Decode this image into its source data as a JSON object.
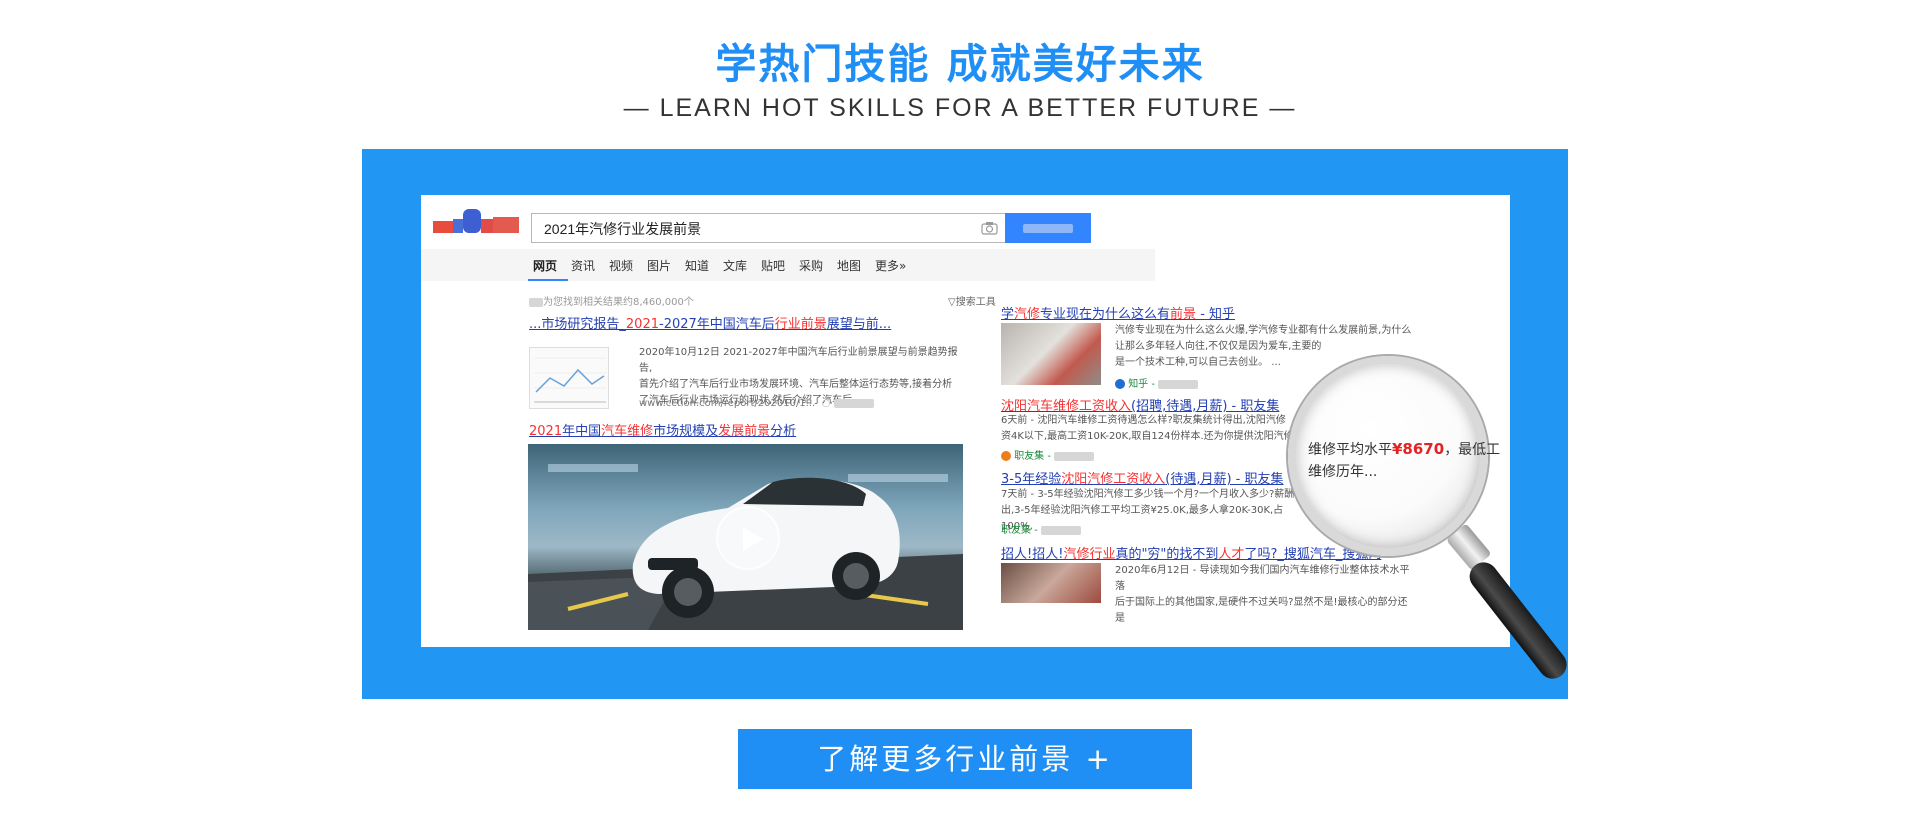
{
  "heading": {
    "title": "学热门技能 成就美好未来",
    "subtitle": "— LEARN HOT SKILLS FOR A BETTER FUTURE —"
  },
  "colors": {
    "accent": "#1f8ff5",
    "frame": "#2196f3",
    "link": "#2440b3",
    "highlight": "#f73131"
  },
  "screenshot": {
    "search": {
      "query": "2021年汽修行业发展前景",
      "button_icon": "camera-icon"
    },
    "tabs": [
      "网页",
      "资讯",
      "视频",
      "图片",
      "知道",
      "文库",
      "贴吧",
      "采购",
      "地图",
      "更多»"
    ],
    "active_tab": "网页",
    "result_count": "为您找到相关结果约8,460,000个",
    "tools_label": "搜索工具",
    "left_results": [
      {
        "title_a": "...市场研究报告_",
        "title_hl1": "2021",
        "title_b": "-2027年中国汽车后",
        "title_hl2": "行业前景",
        "title_c": "展望与前...",
        "snippet_1": "2020年10月12日 2021-2027年中国汽车后行业前景展望与前景趋势报告,",
        "snippet_2": "首先介绍了汽车后行业市场发展环境、汽车后整体运行态势等,接着分析",
        "snippet_3": "了汽车后行业市场运行的现状,然后介绍了汽车后...",
        "url": "www.cction.com/report/202010/1..."
      },
      {
        "title_hl1": "2021",
        "title_a": "年中国",
        "title_hl2": "汽车维修",
        "title_b": "市场规模及",
        "title_hl3": "发展前景",
        "title_c": "分析"
      }
    ],
    "right_results": [
      {
        "title_a": "学",
        "title_hl1": "汽修",
        "title_b": "专业现在为什么这么有",
        "title_hl2": "前景",
        "title_c": " - 知乎",
        "snippet_1": "汽修专业现在为什么这么火爆,学汽修专业都有什么发展前景,为什么",
        "snippet_2": "让那么多年轻人向往,不仅仅是因为爱车,主要的",
        "snippet_3": "是一个技术工种,可以自己去创业。 ...",
        "source": "知乎 -"
      },
      {
        "title_hl1": "沈阳汽车维修工资收入",
        "title_a": "(招聘,待遇,月薪) - 职友集",
        "snippet_1": "6天前 - 沈阳汽车维修工资待遇怎么样?职友集统计得出,沈阳汽修",
        "snippet_2": "资4K以下,最高工资10K-20K,取自124份样本.还为你提供沈阳汽修",
        "source": "职友集 -"
      },
      {
        "title_a": "3-5年经验",
        "title_hl1": "沈阳汽修工资收入",
        "title_b": "(待遇,月薪) - 职友集",
        "snippet_1": "7天前 - 3-5年经验沈阳汽修工多少钱一个月?一个月收入多少?薪酬",
        "snippet_2": "出,3-5年经验沈阳汽修工平均工资¥25.0K,最多人拿20K-30K,占100%,",
        "source": "职友集 -"
      },
      {
        "title_a": "招人!招人!",
        "title_hl1": "汽修行业",
        "title_b": "真的\"穷\"的找不到",
        "title_hl2": "人才",
        "title_c": "了吗?_搜狐汽车_搜狐网",
        "snippet_1": "2020年6月12日 - 导读现如今我们国内汽车维修行业整体技术水平落",
        "snippet_2": "后于国际上的其他国家,是硬件不过关吗?显然不是!最核心的部分还是"
      }
    ],
    "magnifier": {
      "line1_a": "维修平均水平",
      "line1_price": "¥8670",
      "line1_b": "，最低工",
      "line2": "维修历年..."
    }
  },
  "cta_label": "了解更多行业前景  +"
}
